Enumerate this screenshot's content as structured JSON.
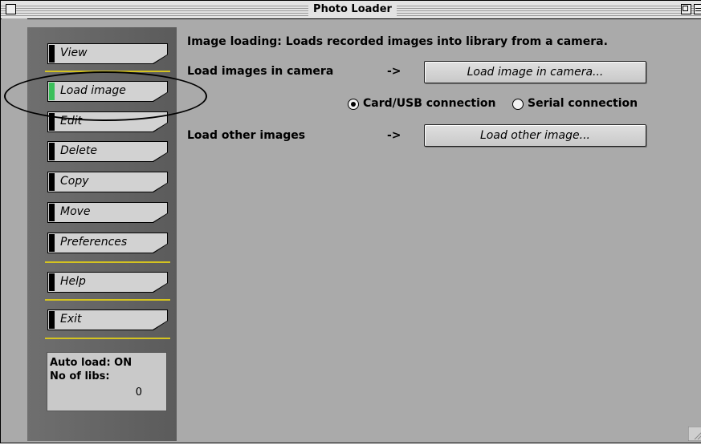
{
  "window": {
    "title": "Photo Loader"
  },
  "sidebar": {
    "items": [
      {
        "label": "View",
        "active": false
      },
      {
        "label": "Load image",
        "active": true
      },
      {
        "label": "Edit",
        "active": false
      },
      {
        "label": "Delete",
        "active": false
      },
      {
        "label": "Copy",
        "active": false
      },
      {
        "label": "Move",
        "active": false
      },
      {
        "label": "Preferences",
        "active": false
      },
      {
        "label": "Help",
        "active": false
      },
      {
        "label": "Exit",
        "active": false
      }
    ],
    "status": {
      "auto_load": "Auto load:  ON",
      "no_of_libs_label": "No of libs:",
      "no_of_libs_value": "0"
    }
  },
  "main": {
    "description": "Image loading: Loads recorded images into library from a camera.",
    "load_camera_label": "Load images in camera",
    "arrow": "->",
    "load_camera_button": "Load image in camera...",
    "connection_options": [
      {
        "label": "Card/USB connection",
        "selected": true
      },
      {
        "label": "Serial connection",
        "selected": false
      }
    ],
    "load_other_label": "Load other images",
    "load_other_button": "Load other image..."
  },
  "colors": {
    "active_tab": "#3bbf5a",
    "divider": "#d4c320",
    "sidebar_bg": "#666666",
    "window_bg": "#aaaaaa"
  }
}
